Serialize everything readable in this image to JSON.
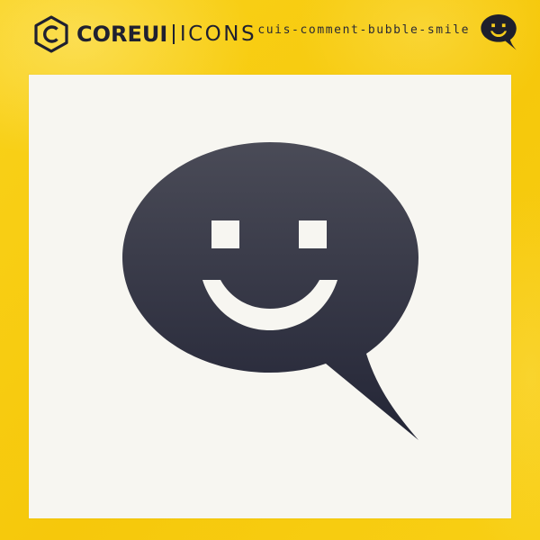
{
  "brand": {
    "core": "COREUI",
    "icons": "ICONS",
    "logo_icon": "coreui-hexagon-c-logo"
  },
  "icon": {
    "name": "cuis-comment-bubble-smile",
    "semantic": "comment-bubble-smile-icon"
  },
  "colors": {
    "background": "#f8cf0e",
    "card": "#f7f6f1",
    "icon_top": "#4a4b57",
    "icon_bottom": "#262838",
    "text_dark": "#1f2030"
  }
}
